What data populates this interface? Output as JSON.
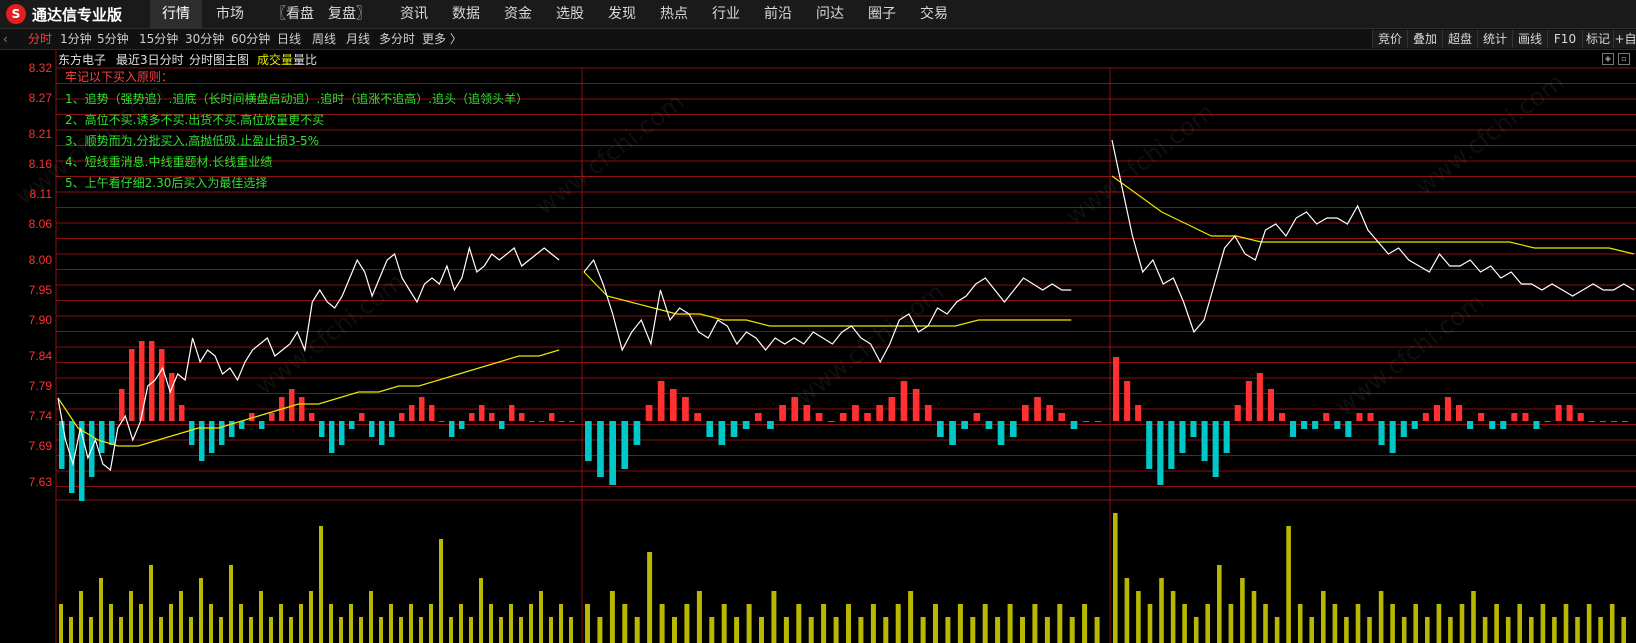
{
  "app": {
    "title": "通达信专业版",
    "logo_glyph": "S"
  },
  "menu": [
    {
      "label": "行情",
      "active": true
    },
    {
      "label": "市场"
    },
    {
      "label": "〖看盘"
    },
    {
      "label": "复盘〗"
    },
    {
      "label": "资讯"
    },
    {
      "label": "数据"
    },
    {
      "label": "资金"
    },
    {
      "label": "选股"
    },
    {
      "label": "发现"
    },
    {
      "label": "热点"
    },
    {
      "label": "行业"
    },
    {
      "label": "前沿"
    },
    {
      "label": "问达"
    },
    {
      "label": "圈子"
    },
    {
      "label": "交易"
    }
  ],
  "periods": [
    "分时",
    "1分钟",
    "5分钟",
    "15分钟",
    "30分钟",
    "60分钟",
    "日线",
    "周线",
    "月线",
    "多分时",
    "更多 〉"
  ],
  "active_period": "分时",
  "left_arrow": "‹",
  "right_tools": [
    "竞价",
    "叠加",
    "超盘",
    "统计",
    "画线",
    "F10",
    "标记",
    "+自"
  ],
  "info": {
    "stock_name": "东方电子",
    "mode": "最近3日分时",
    "main_label": "分时图主图",
    "volume_label": "成交量",
    "ratio_label": "量比"
  },
  "notes": {
    "title": "牢记以下买入原则：",
    "lines": [
      "1、追势（强势追）.追底（长时间横盘启动追）.追时（追涨不追高）.追头（追领头羊）",
      "2、高位不买.诱多不买.出货不买.高位放量更不买",
      "3、顺势而为.分批买入.高抛低吸.止盈止损3-5%",
      "4、短线重消息.中线重题材.长线重业绩",
      "5、上午看仔细2.30后买入为最佳选择"
    ]
  },
  "price_axis": [
    "8.32",
    "8.27",
    "8.21",
    "8.16",
    "8.11",
    "8.06",
    "8.00",
    "7.95",
    "7.90",
    "7.84",
    "7.79",
    "7.74",
    "7.69",
    "7.63"
  ],
  "watermark": "www.cfchi.com",
  "colors": {
    "up": "#ff3030",
    "down": "#00c8c8",
    "price_line": "#ffffff",
    "avg_line": "#e8e800",
    "volume": "#b8b800",
    "grid": "#8a1010",
    "axis_text": "#ff3030",
    "note_title": "#ff4040",
    "note_text": "#30e030"
  },
  "chart_data": {
    "type": "line",
    "title": "",
    "xlabel": "",
    "ylabel": "",
    "ylim": [
      7.6,
      8.32
    ],
    "days": [
      {
        "price": [
          7.77,
          7.7,
          7.66,
          7.72,
          7.67,
          7.7,
          7.66,
          7.65,
          7.72,
          7.74,
          7.7,
          7.73,
          7.79,
          7.8,
          7.82,
          7.78,
          7.81,
          7.8,
          7.87,
          7.83,
          7.85,
          7.84,
          7.81,
          7.82,
          7.8,
          7.83,
          7.85,
          7.86,
          7.87,
          7.84,
          7.85,
          7.86,
          7.88,
          7.85,
          7.93,
          7.95,
          7.93,
          7.92,
          7.94,
          7.97,
          8.0,
          7.98,
          7.94,
          7.97,
          8.0,
          8.01,
          7.97,
          7.95,
          7.93,
          7.96,
          7.97,
          7.96,
          7.99,
          7.95,
          7.97,
          8.02,
          7.98,
          7.99,
          8.01,
          8.0,
          8.01,
          8.02,
          7.99,
          8.0,
          8.01,
          8.02,
          8.01,
          8.0
        ],
        "avg": [
          7.77,
          7.72,
          7.7,
          7.69,
          7.69,
          7.7,
          7.71,
          7.72,
          7.72,
          7.73,
          7.74,
          7.75,
          7.76,
          7.76,
          7.77,
          7.78,
          7.78,
          7.79,
          7.79,
          7.8,
          7.81,
          7.82,
          7.83,
          7.84,
          7.84,
          7.85
        ]
      },
      {
        "price": [
          7.98,
          8.0,
          7.96,
          7.91,
          7.85,
          7.88,
          7.9,
          7.86,
          7.95,
          7.9,
          7.92,
          7.91,
          7.88,
          7.87,
          7.9,
          7.89,
          7.86,
          7.88,
          7.87,
          7.85,
          7.87,
          7.86,
          7.87,
          7.86,
          7.88,
          7.87,
          7.86,
          7.88,
          7.89,
          7.87,
          7.86,
          7.83,
          7.86,
          7.9,
          7.91,
          7.88,
          7.89,
          7.92,
          7.91,
          7.93,
          7.94,
          7.96,
          7.97,
          7.95,
          7.93,
          7.95,
          7.97,
          7.96,
          7.95,
          7.96,
          7.95,
          7.95
        ],
        "avg": [
          7.98,
          7.94,
          7.93,
          7.92,
          7.91,
          7.91,
          7.9,
          7.9,
          7.89,
          7.89,
          7.89,
          7.89,
          7.89,
          7.89,
          7.89,
          7.89,
          7.89,
          7.9,
          7.9,
          7.9,
          7.9,
          7.9
        ]
      },
      {
        "price": [
          8.2,
          8.12,
          8.04,
          7.98,
          8.0,
          7.96,
          7.97,
          7.93,
          7.88,
          7.9,
          7.96,
          8.02,
          8.04,
          8.01,
          8.0,
          8.05,
          8.06,
          8.04,
          8.07,
          8.08,
          8.06,
          8.07,
          8.07,
          8.06,
          8.09,
          8.05,
          8.03,
          8.01,
          8.02,
          8.0,
          7.99,
          7.98,
          8.01,
          7.99,
          7.99,
          8.0,
          7.98,
          7.99,
          7.97,
          7.98,
          7.96,
          7.96,
          7.95,
          7.96,
          7.95,
          7.94,
          7.95,
          7.96,
          7.95,
          7.95,
          7.96,
          7.95
        ],
        "avg": [
          8.14,
          8.11,
          8.08,
          8.06,
          8.04,
          8.04,
          8.03,
          8.03,
          8.03,
          8.03,
          8.03,
          8.03,
          8.03,
          8.03,
          8.03,
          8.03,
          8.03,
          8.02,
          8.02,
          8.02,
          8.02,
          8.01
        ]
      }
    ],
    "ratio_bars": [
      [
        -0.6,
        -0.9,
        -1.0,
        -0.7,
        -0.4,
        -0.3,
        0.4,
        0.9,
        1.0,
        1.0,
        0.9,
        0.6,
        0.2,
        -0.3,
        -0.5,
        -0.4,
        -0.3,
        -0.2,
        -0.1,
        0.1,
        -0.1,
        0.1,
        0.3,
        0.4,
        0.3,
        0.1,
        -0.2,
        -0.4,
        -0.3,
        -0.1,
        0.1,
        -0.2,
        -0.3,
        -0.2,
        0.1,
        0.2,
        0.3,
        0.2,
        0.0,
        -0.2,
        -0.1,
        0.1,
        0.2,
        0.1,
        -0.1,
        0.2,
        0.1,
        0.0,
        0.0,
        0.1,
        0.0,
        0.0
      ],
      [
        -0.5,
        -0.7,
        -0.8,
        -0.6,
        -0.3,
        0.2,
        0.5,
        0.4,
        0.3,
        0.1,
        -0.2,
        -0.3,
        -0.2,
        -0.1,
        0.1,
        -0.1,
        0.2,
        0.3,
        0.2,
        0.1,
        0.0,
        0.1,
        0.2,
        0.1,
        0.2,
        0.3,
        0.5,
        0.4,
        0.2,
        -0.2,
        -0.3,
        -0.1,
        0.1,
        -0.1,
        -0.3,
        -0.2,
        0.2,
        0.3,
        0.2,
        0.1,
        -0.1,
        0.0,
        0.0
      ],
      [
        0.8,
        0.5,
        0.2,
        -0.6,
        -0.8,
        -0.6,
        -0.4,
        -0.2,
        -0.5,
        -0.7,
        -0.4,
        0.2,
        0.5,
        0.6,
        0.4,
        0.1,
        -0.2,
        -0.1,
        -0.1,
        0.1,
        -0.1,
        -0.2,
        0.1,
        0.1,
        -0.3,
        -0.4,
        -0.2,
        -0.1,
        0.1,
        0.2,
        0.3,
        0.2,
        -0.1,
        0.1,
        -0.1,
        -0.1,
        0.1,
        0.1,
        -0.1,
        0.0,
        0.2,
        0.2,
        0.1,
        0.0,
        0.0,
        0.0,
        0.0
      ]
    ],
    "volume_bars": [
      [
        0.3,
        0.2,
        0.4,
        0.2,
        0.5,
        0.3,
        0.2,
        0.4,
        0.3,
        0.6,
        0.2,
        0.3,
        0.4,
        0.2,
        0.5,
        0.3,
        0.2,
        0.6,
        0.3,
        0.2,
        0.4,
        0.2,
        0.3,
        0.2,
        0.3,
        0.4,
        0.9,
        0.3,
        0.2,
        0.3,
        0.2,
        0.4,
        0.2,
        0.3,
        0.2,
        0.3,
        0.2,
        0.3,
        0.8,
        0.2,
        0.3,
        0.2,
        0.5,
        0.3,
        0.2,
        0.3,
        0.2,
        0.3,
        0.4,
        0.2,
        0.3,
        0.2
      ],
      [
        0.3,
        0.2,
        0.4,
        0.3,
        0.2,
        0.7,
        0.3,
        0.2,
        0.3,
        0.4,
        0.2,
        0.3,
        0.2,
        0.3,
        0.2,
        0.4,
        0.2,
        0.3,
        0.2,
        0.3,
        0.2,
        0.3,
        0.2,
        0.3,
        0.2,
        0.3,
        0.4,
        0.2,
        0.3,
        0.2,
        0.3,
        0.2,
        0.3,
        0.2,
        0.3,
        0.2,
        0.3,
        0.2,
        0.3,
        0.2,
        0.3,
        0.2
      ],
      [
        1.0,
        0.5,
        0.4,
        0.3,
        0.5,
        0.4,
        0.3,
        0.2,
        0.3,
        0.6,
        0.3,
        0.5,
        0.4,
        0.3,
        0.2,
        0.9,
        0.3,
        0.2,
        0.4,
        0.3,
        0.2,
        0.3,
        0.2,
        0.4,
        0.3,
        0.2,
        0.3,
        0.2,
        0.3,
        0.2,
        0.3,
        0.4,
        0.2,
        0.3,
        0.2,
        0.3,
        0.2,
        0.3,
        0.2,
        0.3,
        0.2,
        0.3,
        0.2,
        0.3,
        0.2
      ]
    ]
  }
}
